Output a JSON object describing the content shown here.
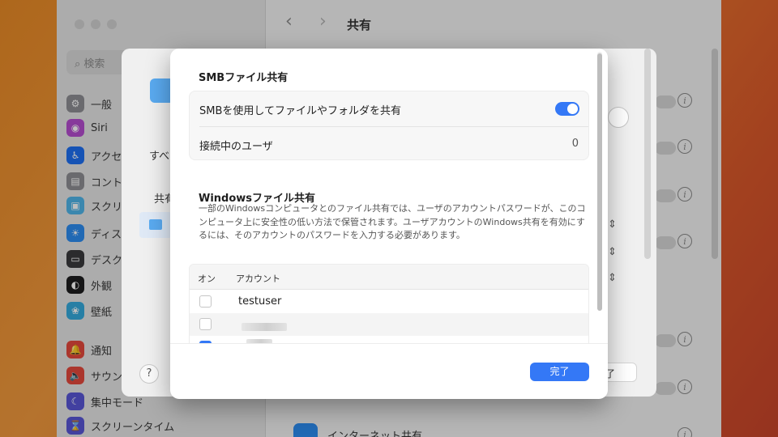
{
  "background_window": {
    "search_placeholder": "検索",
    "header_title": "共有",
    "sidebar_items": [
      {
        "label": "一般",
        "icon": "gear-icon",
        "color": "#8e8e93"
      },
      {
        "label": "Siri",
        "icon": "siri-icon",
        "color": "#b44ccf"
      },
      {
        "label": "アクセ",
        "icon": "accessibility-icon",
        "color": "#1e6ff2"
      },
      {
        "label": "コント",
        "icon": "control-center-icon",
        "color": "#8e8e93"
      },
      {
        "label": "スクリ",
        "icon": "screen-saver-icon",
        "color": "#4fb4e8"
      },
      {
        "label": "ディス",
        "icon": "display-icon",
        "color": "#2d8cf0"
      },
      {
        "label": "デスク",
        "icon": "desktop-dock-icon",
        "color": "#3a3a3c"
      },
      {
        "label": "外観",
        "icon": "appearance-icon",
        "color": "#1c1c1e"
      },
      {
        "label": "壁紙",
        "icon": "wallpaper-icon",
        "color": "#34aadc"
      },
      {
        "label": "通知",
        "icon": "bell-icon",
        "color": "#e5483d"
      },
      {
        "label": "サウン",
        "icon": "sound-icon",
        "color": "#e5483d"
      },
      {
        "label": "集中モード",
        "icon": "moon-icon",
        "color": "#5856d6"
      },
      {
        "label": "スクリーンタイム",
        "icon": "hourglass-icon",
        "color": "#5856d6"
      }
    ],
    "sheet_labels": [
      "すべ",
      "共有"
    ],
    "sheet_button_partial": "了",
    "internet_sharing_label": "インターネット共有"
  },
  "dialog": {
    "smb_section_title": "SMBファイル共有",
    "smb_toggle_label": "SMBを使用してファイルやフォルダを共有",
    "smb_toggle_on": true,
    "connected_users_label": "接続中のユーザ",
    "connected_users_count": "0",
    "windows_section_title": "Windowsファイル共有",
    "windows_description": "一部のWindowsコンピュータとのファイル共有では、ユーザのアカウントパスワードが、このコンピュータ上に安全性の低い方法で保管されます。ユーザアカウントのWindows共有を有効にするには、そのアカウントのパスワードを入力する必要があります。",
    "table": {
      "col_on": "オン",
      "col_account": "アカウント",
      "rows": [
        {
          "account": "testuser",
          "checked": false
        },
        {
          "account": "",
          "checked": false
        },
        {
          "account": "",
          "checked": true
        }
      ]
    },
    "done_label": "完了"
  },
  "help_label": "?",
  "colors": {
    "accent": "#3478f6"
  }
}
